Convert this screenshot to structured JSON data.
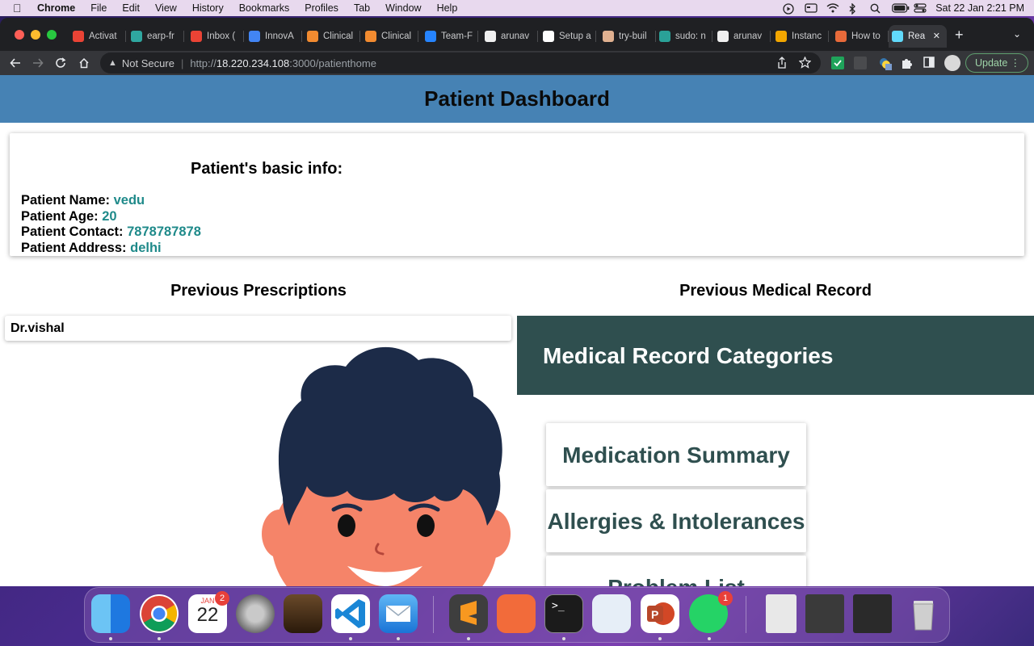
{
  "menubar": {
    "app": "Chrome",
    "items": [
      "File",
      "Edit",
      "View",
      "History",
      "Bookmarks",
      "Profiles",
      "Tab",
      "Window",
      "Help"
    ],
    "clock": "Sat 22 Jan  2:21 PM"
  },
  "browser": {
    "tabs": [
      {
        "label": "Activat",
        "icon": "gmail-icon",
        "color": "#ea4335"
      },
      {
        "label": "earp-fr",
        "icon": "document-icon",
        "color": "#2fa7a0"
      },
      {
        "label": "Inbox (",
        "icon": "gmail-icon",
        "color": "#ea4335"
      },
      {
        "label": "InnovA",
        "icon": "calendar-icon",
        "color": "#4285f4"
      },
      {
        "label": "Clinical",
        "icon": "openmrs-icon",
        "color": "#f28b30"
      },
      {
        "label": "Clinical",
        "icon": "openmrs-icon",
        "color": "#f28b30"
      },
      {
        "label": "Team-F",
        "icon": "jira-icon",
        "color": "#2684ff"
      },
      {
        "label": "arunav",
        "icon": "github-icon",
        "color": "#f0f0f0"
      },
      {
        "label": "Setup a",
        "icon": "medium-icon",
        "color": "#ffffff"
      },
      {
        "label": "try-buil",
        "icon": "avatar-icon",
        "color": "#e0b090"
      },
      {
        "label": "sudo: n",
        "icon": "stackexchange-icon",
        "color": "#2aa198"
      },
      {
        "label": "arunav",
        "icon": "github-icon",
        "color": "#f0f0f0"
      },
      {
        "label": "Instanc",
        "icon": "aws-box-icon",
        "color": "#f2a600"
      },
      {
        "label": "How to",
        "icon": "blog-icon",
        "color": "#e86a3a"
      },
      {
        "label": "Rea",
        "icon": "react-icon",
        "color": "#61dafb",
        "active": true
      }
    ],
    "omnibox": {
      "security": "Not Secure",
      "url_prefix": "http://",
      "url_host": "18.220.234.108",
      "url_path": ":3000/patienthome"
    },
    "update_label": "Update"
  },
  "page": {
    "title": "Patient Dashboard",
    "basic_info": {
      "heading": "Patient's basic info:",
      "name_label": "Patient Name:",
      "name": "vedu",
      "age_label": "Patient Age:",
      "age": "20",
      "contact_label": "Patient Contact:",
      "contact": "7878787878",
      "address_label": "Patient Address:",
      "address": "delhi"
    },
    "prescriptions": {
      "heading": "Previous Prescriptions",
      "items": [
        "Dr.vishal"
      ]
    },
    "medical_record": {
      "heading": "Previous Medical Record",
      "banner": "Medical Record Categories",
      "categories": [
        "Medication Summary",
        "Allergies & Intolerances",
        "Problem List"
      ]
    }
  },
  "dock": {
    "calendar_month": "JAN",
    "calendar_day": "22",
    "calendar_badge": "2",
    "whatsapp_badge": "1"
  },
  "colors": {
    "header_bg": "#4682b4",
    "value_teal": "#1f8a8a",
    "category_green": "#2f4f4f"
  }
}
